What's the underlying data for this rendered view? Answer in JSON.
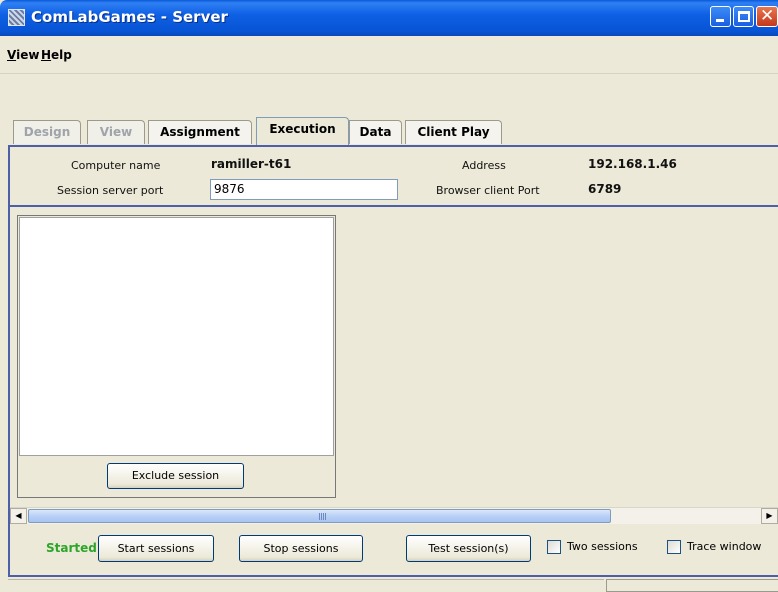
{
  "window": {
    "title": "ComLabGames - Server"
  },
  "menu": {
    "view": {
      "mnemonic": "V",
      "rest": "iew"
    },
    "help": {
      "mnemonic": "H",
      "rest": "elp"
    }
  },
  "tabs": [
    {
      "label": "Design",
      "state": "disabled"
    },
    {
      "label": "View",
      "state": "disabled"
    },
    {
      "label": "Assignment",
      "state": "normal"
    },
    {
      "label": "Execution",
      "state": "selected"
    },
    {
      "label": "Data",
      "state": "normal"
    },
    {
      "label": "Client Play",
      "state": "normal"
    }
  ],
  "info": {
    "computer_name_label": "Computer name",
    "computer_name_value": "ramiller-t61",
    "address_label": "Address",
    "address_value": "192.168.1.46",
    "session_port_label": "Session server port",
    "session_port_value": "9876",
    "browser_port_label": "Browser client Port",
    "browser_port_value": "6789"
  },
  "session_panel": {
    "exclude_button": "Exclude session"
  },
  "controls": {
    "status": "Started",
    "status_color": "#2ca628",
    "start_button": "Start sessions",
    "stop_button": "Stop sessions",
    "test_button": "Test session(s)",
    "two_sessions_label": "Two sessions",
    "two_sessions_checked": false,
    "trace_window_label": "Trace window",
    "trace_window_checked": false
  },
  "icons": {
    "app": "comlab-app-icon",
    "minimize": "minimize-icon",
    "maximize": "maximize-icon",
    "close": "close-icon",
    "scroll_left": "arrow-left-icon",
    "scroll_right": "arrow-right-icon"
  }
}
